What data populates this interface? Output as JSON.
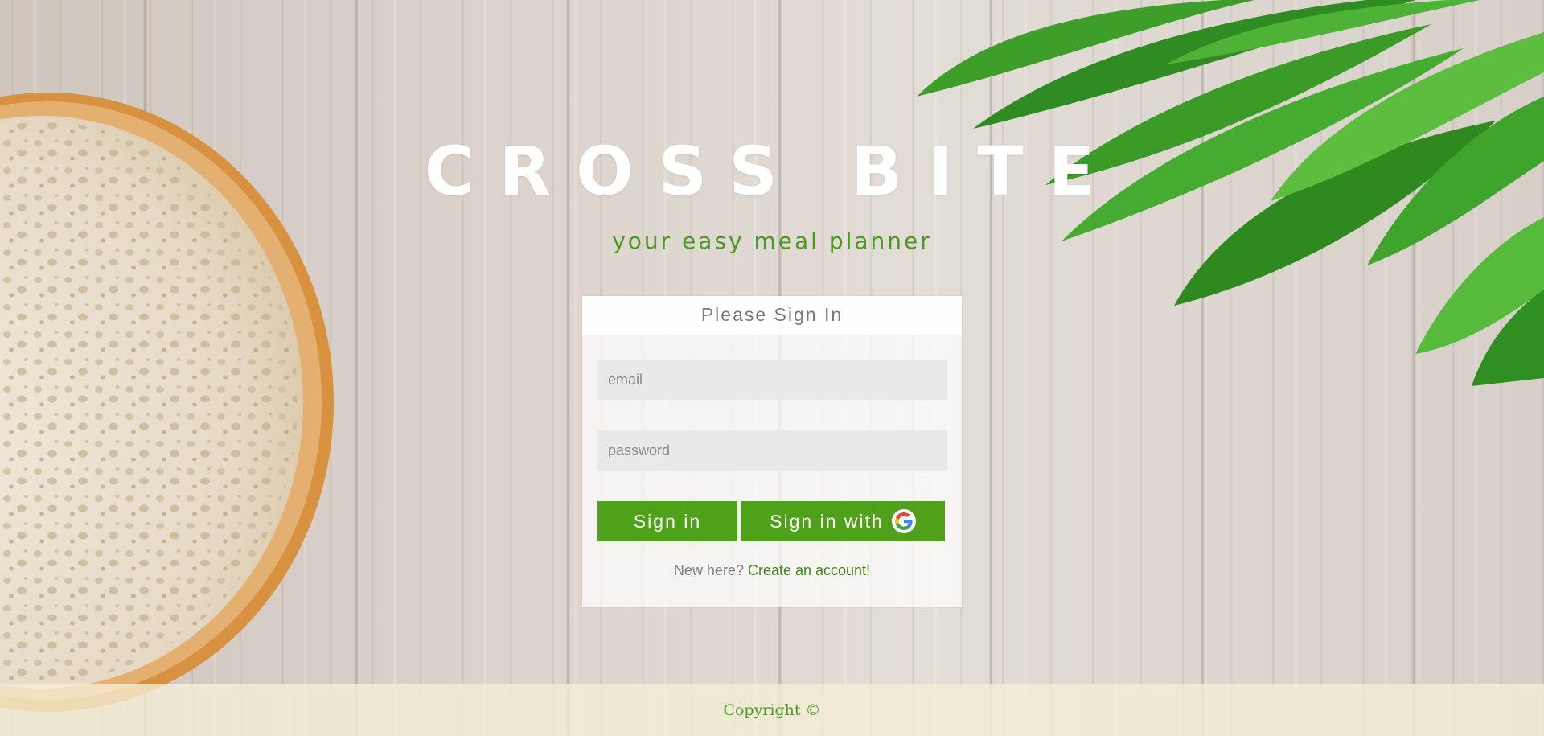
{
  "brand": {
    "title": "CROSS BITE",
    "subtitle": "your easy meal planner"
  },
  "signin": {
    "heading": "Please Sign In",
    "email_placeholder": "email",
    "password_placeholder": "password",
    "signin_label": "Sign in",
    "google_label": "Sign in with",
    "google_icon": "google-icon",
    "new_here": "New here?",
    "create_account": "Create an account!"
  },
  "footer": {
    "copyright": "Copyright ©"
  },
  "colors": {
    "accent": "#4fa11a",
    "subtitle": "#4a9a1e",
    "link": "#3e8a14"
  }
}
